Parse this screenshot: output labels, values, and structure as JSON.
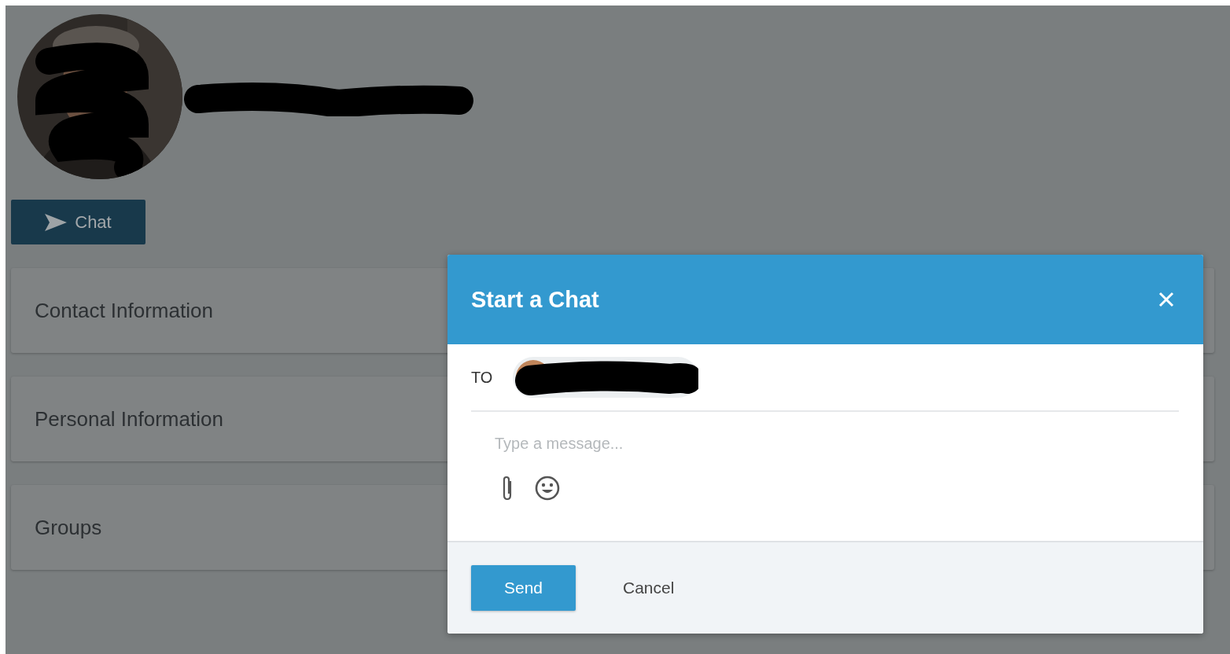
{
  "profile": {
    "chat_button": {
      "label": "Chat"
    }
  },
  "sections": [
    {
      "title": "Contact Information"
    },
    {
      "title": "Personal Information"
    },
    {
      "title": "Groups"
    }
  ],
  "dialog": {
    "title": "Start a Chat",
    "to_label": "TO",
    "message": {
      "placeholder": "Type a message..."
    },
    "buttons": [
      {
        "label": "Send",
        "kind": "primary"
      },
      {
        "label": "Cancel",
        "kind": "secondary"
      }
    ]
  }
}
